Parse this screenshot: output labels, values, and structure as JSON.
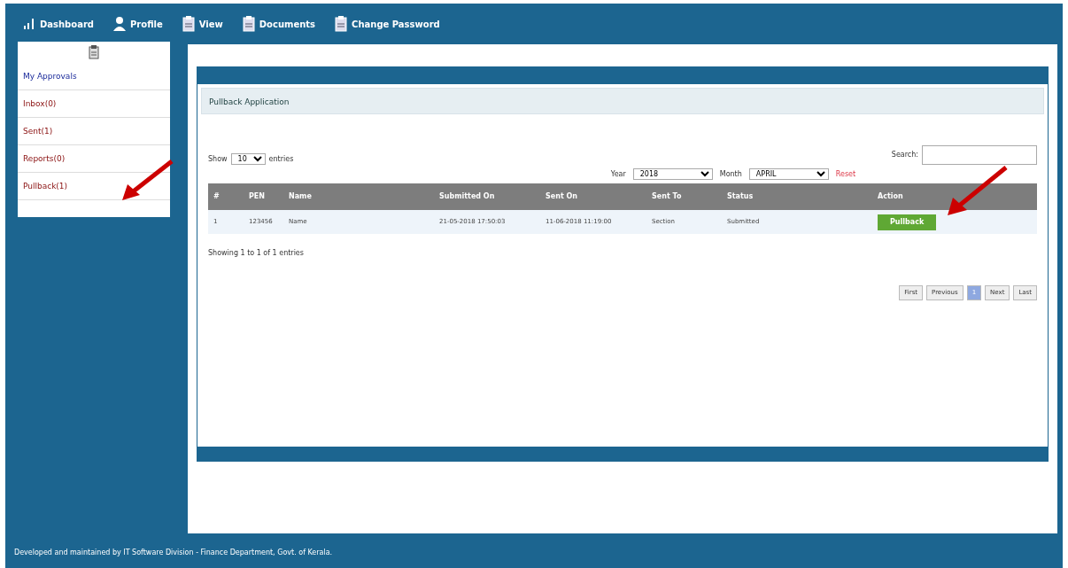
{
  "nav": [
    {
      "kind": "chart",
      "label": "Dashboard"
    },
    {
      "kind": "person",
      "label": "Profile"
    },
    {
      "kind": "doc",
      "label": "View"
    },
    {
      "kind": "doc",
      "label": "Documents"
    },
    {
      "kind": "doc",
      "label": "Change Password"
    }
  ],
  "sidebar": {
    "items": [
      {
        "label": "My Approvals",
        "kind": "heading"
      },
      {
        "label": "Inbox(0)",
        "kind": "link"
      },
      {
        "label": "Sent(1)",
        "kind": "link"
      },
      {
        "label": "Reports(0)",
        "kind": "link"
      },
      {
        "label": "Pullback(1)",
        "kind": "link"
      }
    ]
  },
  "panel": {
    "title": "Pullback Application",
    "length": {
      "before": "Show",
      "value": "10",
      "after": "entries"
    },
    "search": {
      "label": "Search:"
    },
    "filters": {
      "year_label": "Year",
      "year": "2018",
      "month_label": "Month",
      "month": "APRIL",
      "reset": "Reset"
    },
    "table": {
      "columns": [
        "#",
        "PEN",
        "Name",
        "Submitted On",
        "Sent On",
        "Sent To",
        "Status",
        "",
        "Action"
      ],
      "rows": [
        {
          "cells": [
            "1",
            "123456",
            "Name",
            "21-05-2018 17:50:03",
            "11-06-2018 11:19:00",
            "Section",
            "Submitted",
            ""
          ],
          "action": "Pullback"
        }
      ]
    },
    "info": "Showing 1 to 1 of 1 entries",
    "pagination": [
      {
        "label": "First",
        "selected": false
      },
      {
        "label": "Previous",
        "selected": false
      },
      {
        "label": "1",
        "selected": true
      },
      {
        "label": "Next",
        "selected": false
      },
      {
        "label": "Last",
        "selected": false
      }
    ]
  },
  "footer": "Developed and maintained by IT Software Division - Finance Department, Govt. of Kerala."
}
